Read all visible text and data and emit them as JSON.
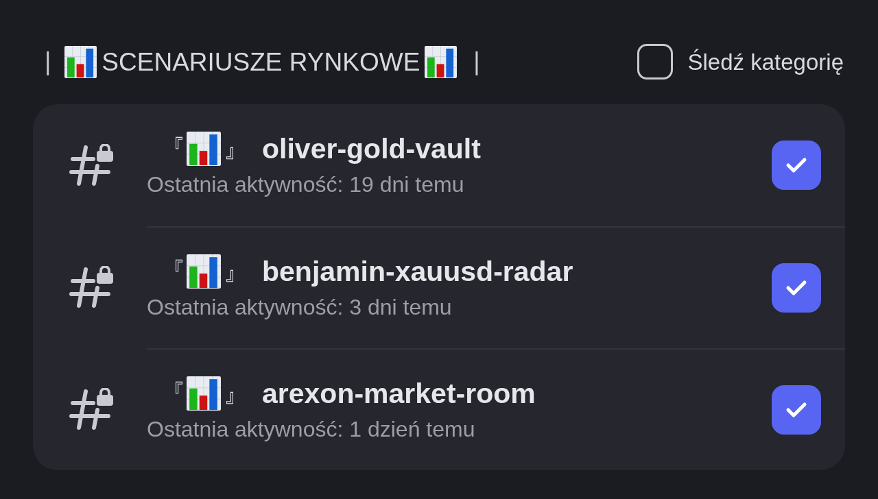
{
  "header": {
    "left_separator": "|",
    "title": "SCENARIUSZE RYNKOWE",
    "right_separator": "|",
    "follow": {
      "label": "Śledź kategorię",
      "checked": false
    }
  },
  "channels": [
    {
      "bracket_open": "『",
      "bracket_close": "』",
      "name": "oliver-gold-vault",
      "activity": "Ostatnia aktywność: 19 dni temu",
      "checked": true
    },
    {
      "bracket_open": "『",
      "bracket_close": "』",
      "name": "benjamin-xauusd-radar",
      "activity": "Ostatnia aktywność: 3 dni temu",
      "checked": true
    },
    {
      "bracket_open": "『",
      "bracket_close": "』",
      "name": "arexon-market-room",
      "activity": "Ostatnia aktywność: 1 dzień temu",
      "checked": true
    }
  ]
}
